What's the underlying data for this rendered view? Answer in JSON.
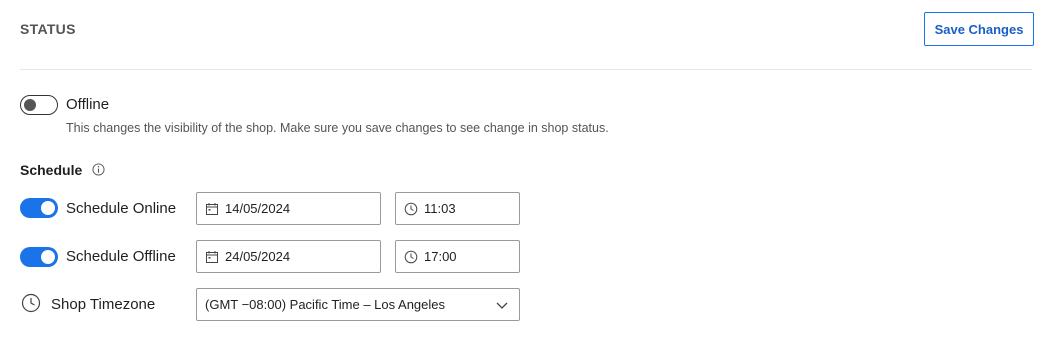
{
  "header": {
    "title": "STATUS",
    "save_label": "Save Changes"
  },
  "status": {
    "toggle_on": false,
    "label": "Offline",
    "description": "This changes the visibility of the shop. Make sure you save changes to see change in shop status."
  },
  "schedule": {
    "title": "Schedule",
    "rows": [
      {
        "label": "Schedule Online",
        "enabled": true,
        "date": "14/05/2024",
        "time": "11:03"
      },
      {
        "label": "Schedule Offline",
        "enabled": true,
        "date": "24/05/2024",
        "time": "17:00"
      }
    ],
    "timezone": {
      "label": "Shop Timezone",
      "value": "(GMT −08:00) Pacific Time – Los Angeles"
    }
  },
  "colors": {
    "accent": "#1a73e8",
    "border": "#9a9a9a",
    "text": "#1f1f1f",
    "muted": "#555555"
  }
}
